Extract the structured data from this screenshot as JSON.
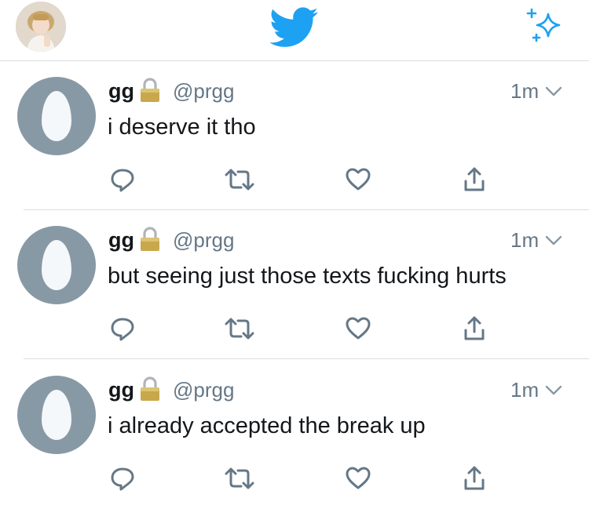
{
  "header": {
    "profile_avatar": "profile-photo",
    "logo_icon": "twitter-bird-icon",
    "sparkle_icon": "sparkle-icon",
    "accent_color": "#1da1f2"
  },
  "tweets": [
    {
      "name": "gg",
      "handle": "@prgg",
      "time": "1m",
      "text": "i deserve it tho"
    },
    {
      "name": "gg",
      "handle": "@prgg",
      "time": "1m",
      "text": "but seeing just those texts fucking hurts"
    },
    {
      "name": "gg",
      "handle": "@prgg",
      "time": "1m",
      "text": "i already accepted the break up"
    }
  ],
  "actions": [
    "reply-icon",
    "retweet-icon",
    "like-icon",
    "share-icon"
  ],
  "colors": {
    "secondary_text": "#657786",
    "icon": "#657786",
    "divider": "#d9dde1",
    "egg_bg": "#8899a6"
  }
}
